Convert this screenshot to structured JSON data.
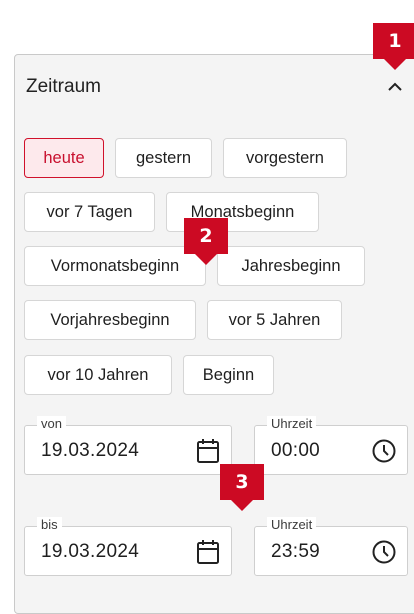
{
  "panel": {
    "title": "Zeitraum",
    "collapse_icon": "chevron-up-icon"
  },
  "quick_ranges": {
    "active": "heute",
    "items": [
      "heute",
      "gestern",
      "vorgestern",
      "vor 7 Tagen",
      "Monatsbeginn",
      "Vormonatsbeginn",
      "Jahresbeginn",
      "Vorjahresbeginn",
      "vor 5 Jahren",
      "vor 10 Jahren",
      "Beginn"
    ]
  },
  "from": {
    "date_label": "von",
    "date_value": "19.03.2024",
    "date_icon": "calendar-icon",
    "time_label": "Uhrzeit",
    "time_value": "00:00",
    "time_icon": "clock-icon"
  },
  "to": {
    "date_label": "bis",
    "date_value": "19.03.2024",
    "date_icon": "calendar-icon",
    "time_label": "Uhrzeit",
    "time_value": "23:59",
    "time_icon": "clock-icon"
  },
  "callouts": [
    "1",
    "2",
    "3"
  ],
  "colors": {
    "accent": "#c8102e",
    "active_bg": "#fde9ec",
    "panel_bg": "#f4f4f4"
  }
}
